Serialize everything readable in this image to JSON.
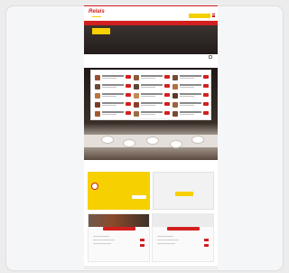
{
  "header": {
    "logo": "Relais",
    "utility_text": "",
    "cta_label": "",
    "nav_items": [
      "",
      "",
      "",
      "",
      ""
    ]
  },
  "hero": {
    "badge_text": "",
    "title": "",
    "subtitle": ""
  },
  "menu": {
    "heading": "",
    "subheading": ""
  },
  "promos": {
    "loyalty_title": "",
    "loyalty_button": "",
    "gift_title": "",
    "gift_button": ""
  },
  "order": {
    "left_button": "",
    "right_button": ""
  },
  "footer": {
    "text": ""
  },
  "colors": {
    "brand_red": "#d31f1f",
    "brand_yellow": "#f6d000"
  }
}
